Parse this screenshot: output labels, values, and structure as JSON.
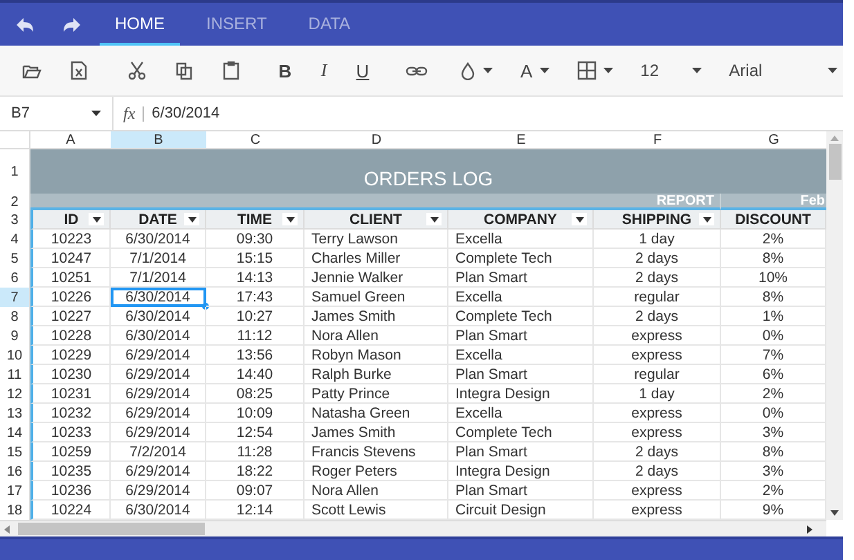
{
  "tabs": [
    {
      "label": "HOME",
      "selected": true
    },
    {
      "label": "INSERT",
      "selected": false
    },
    {
      "label": "DATA",
      "selected": false
    }
  ],
  "toolbar": {
    "bold": "B",
    "italic": "I",
    "underline": "U",
    "font_color": "A",
    "font_size": "12",
    "font_family": "Arial"
  },
  "formula_bar": {
    "name_box": "B7",
    "fx": "fx",
    "value": "6/30/2014"
  },
  "grid": {
    "columns": [
      {
        "letter": "A",
        "selected": false
      },
      {
        "letter": "B",
        "selected": true
      },
      {
        "letter": "C",
        "selected": false
      },
      {
        "letter": "D",
        "selected": false
      },
      {
        "letter": "E",
        "selected": false
      },
      {
        "letter": "F",
        "selected": false
      },
      {
        "letter": "G",
        "selected": false
      }
    ],
    "title_row": {
      "number": "1",
      "text": "ORDERS LOG"
    },
    "subtitle_row": {
      "number": "2",
      "report": "REPORT",
      "next": "Feb"
    },
    "header_row": {
      "number": "3",
      "cells": [
        {
          "text": "ID",
          "filter": true
        },
        {
          "text": "DATE",
          "filter": true
        },
        {
          "text": "TIME",
          "filter": true
        },
        {
          "text": "CLIENT",
          "filter": true
        },
        {
          "text": "COMPANY",
          "filter": true
        },
        {
          "text": "SHIPPING",
          "filter": true
        },
        {
          "text": "DISCOUNT",
          "filter": false
        }
      ]
    },
    "rows": [
      {
        "number": "4",
        "selected": false,
        "cells": [
          "10223",
          "6/30/2014",
          "09:30",
          "Terry Lawson",
          "Excella",
          "1 day",
          "2%"
        ]
      },
      {
        "number": "5",
        "selected": false,
        "cells": [
          "10247",
          "7/1/2014",
          "15:15",
          "Charles Miller",
          "Complete Tech",
          "2 days",
          "8%"
        ]
      },
      {
        "number": "6",
        "selected": false,
        "cells": [
          "10251",
          "7/1/2014",
          "14:13",
          "Jennie Walker",
          "Plan Smart",
          "2 days",
          "10%"
        ]
      },
      {
        "number": "7",
        "selected": true,
        "cells": [
          "10226",
          "6/30/2014",
          "17:43",
          "Samuel Green",
          "Excella",
          "regular",
          "8%"
        ]
      },
      {
        "number": "8",
        "selected": false,
        "cells": [
          "10227",
          "6/30/2014",
          "10:27",
          "James Smith",
          "Complete Tech",
          "2 days",
          "1%"
        ]
      },
      {
        "number": "9",
        "selected": false,
        "cells": [
          "10228",
          "6/30/2014",
          "11:12",
          "Nora Allen",
          "Plan Smart",
          "express",
          "0%"
        ]
      },
      {
        "number": "10",
        "selected": false,
        "cells": [
          "10229",
          "6/29/2014",
          "13:56",
          "Robyn Mason",
          "Excella",
          "express",
          "7%"
        ]
      },
      {
        "number": "11",
        "selected": false,
        "cells": [
          "10230",
          "6/29/2014",
          "14:40",
          "Ralph Burke",
          "Plan Smart",
          "regular",
          "6%"
        ]
      },
      {
        "number": "12",
        "selected": false,
        "cells": [
          "10231",
          "6/29/2014",
          "08:25",
          "Patty Prince",
          "Integra Design",
          "1 day",
          "2%"
        ]
      },
      {
        "number": "13",
        "selected": false,
        "cells": [
          "10232",
          "6/29/2014",
          "10:09",
          "Natasha Green",
          "Excella",
          "express",
          "0%"
        ]
      },
      {
        "number": "14",
        "selected": false,
        "cells": [
          "10233",
          "6/29/2014",
          "12:54",
          "James Smith",
          "Complete Tech",
          "express",
          "3%"
        ]
      },
      {
        "number": "15",
        "selected": false,
        "cells": [
          "10259",
          "7/2/2014",
          "11:28",
          "Francis Stevens",
          "Plan Smart",
          "2 days",
          "8%"
        ]
      },
      {
        "number": "16",
        "selected": false,
        "cells": [
          "10235",
          "6/29/2014",
          "18:22",
          "Roger Peters",
          "Integra Design",
          "2 days",
          "3%"
        ]
      },
      {
        "number": "17",
        "selected": false,
        "cells": [
          "10236",
          "6/29/2014",
          "09:07",
          "Nora Allen",
          "Plan Smart",
          "express",
          "2%"
        ]
      },
      {
        "number": "18",
        "selected": false,
        "cells": [
          "10224",
          "6/30/2014",
          "12:14",
          "Scott Lewis",
          "Circuit Design",
          "express",
          "9%"
        ]
      }
    ]
  }
}
